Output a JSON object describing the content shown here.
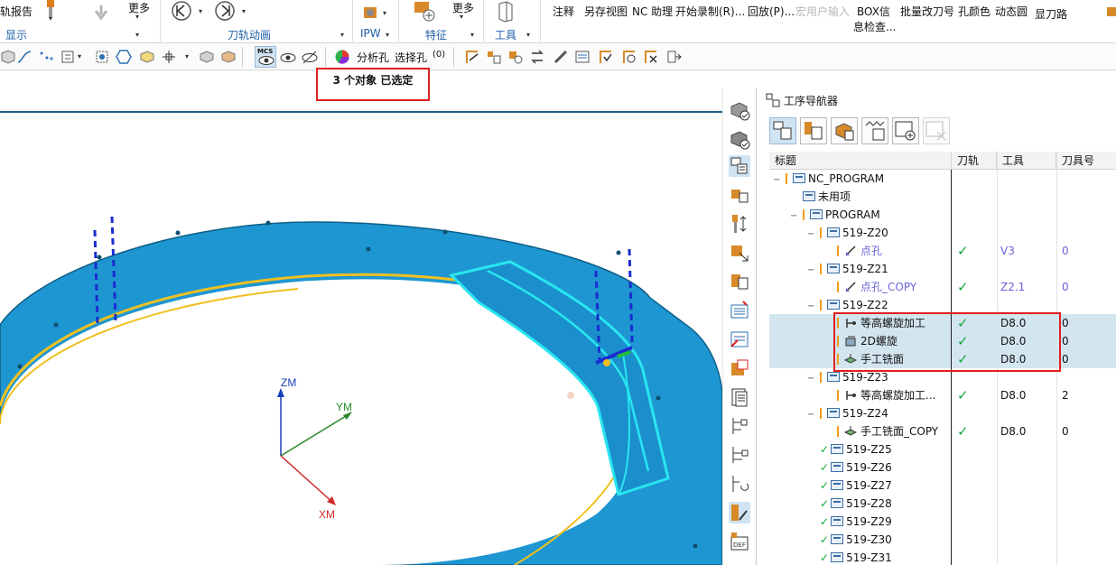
{
  "ribbon": {
    "report_label": "轨报告",
    "more_label_1": "更多",
    "group_display": "显示",
    "group_toolpath_anim": "刀轨动画",
    "group_ipw": "IPW",
    "group_feature": "特征",
    "more_label_2": "更多",
    "group_tools": "工具",
    "annotate": "注释",
    "save_view": "另存视图",
    "nc_assistant": "NC 助理",
    "start_record": "开始录制(R)...",
    "playback": "回放(P)...",
    "macro_input": "宏用户输入",
    "box_info_line1": "BOX信",
    "box_info_line2": "息检查...",
    "batch_change_tool": "批量改刀号",
    "hole_color": "孔颜色",
    "dynamic_circle": "动态圆",
    "show_toolpath": "显刀路"
  },
  "toolbar": {
    "analyze_hole": "分析孔",
    "select_hole": "选择孔",
    "mcs_label": "MCS",
    "hole_count_label": "(0)"
  },
  "status": {
    "selected_text": "3 个对象 已选定"
  },
  "viewport": {
    "axis_z": "ZM",
    "axis_y": "YM",
    "axis_x": "XM"
  },
  "navigator": {
    "title": "工序导航器",
    "columns": [
      "标题",
      "刀轨",
      "工具",
      "刀具号"
    ],
    "rows": [
      {
        "name": "NC_PROGRAM",
        "indent": 0,
        "type": "root",
        "path": "",
        "tool": "",
        "num": "",
        "expander": "−",
        "flag": true,
        "highlight": false,
        "blue": false
      },
      {
        "name": "未用项",
        "indent": 1,
        "type": "folder",
        "path": "",
        "tool": "",
        "num": "",
        "expander": "",
        "flag": false,
        "highlight": false,
        "blue": false
      },
      {
        "name": "PROGRAM",
        "indent": 1,
        "type": "folder",
        "path": "",
        "tool": "",
        "num": "",
        "expander": "−",
        "flag": true,
        "highlight": false,
        "blue": false
      },
      {
        "name": "519-Z20",
        "indent": 2,
        "type": "folder",
        "path": "",
        "tool": "",
        "num": "",
        "expander": "−",
        "flag": true,
        "highlight": false,
        "blue": false
      },
      {
        "name": "点孔",
        "indent": 3,
        "type": "op-drill",
        "path": "✓",
        "tool": "V3",
        "num": "0",
        "expander": "",
        "flag": true,
        "highlight": false,
        "blue": true
      },
      {
        "name": "519-Z21",
        "indent": 2,
        "type": "folder",
        "path": "",
        "tool": "",
        "num": "",
        "expander": "−",
        "flag": true,
        "highlight": false,
        "blue": false
      },
      {
        "name": "点孔_COPY",
        "indent": 3,
        "type": "op-drill",
        "path": "✓",
        "tool": "Z2.1",
        "num": "0",
        "expander": "",
        "flag": true,
        "highlight": false,
        "blue": true
      },
      {
        "name": "519-Z22",
        "indent": 2,
        "type": "folder",
        "path": "",
        "tool": "",
        "num": "",
        "expander": "−",
        "flag": true,
        "highlight": false,
        "blue": false
      },
      {
        "name": "等高螺旋加工",
        "indent": 3,
        "type": "op-helix",
        "path": "✓",
        "tool": "D8.0",
        "num": "0",
        "expander": "",
        "flag": true,
        "highlight": true,
        "blue": false
      },
      {
        "name": "2D螺旋",
        "indent": 3,
        "type": "op-2d",
        "path": "✓",
        "tool": "D8.0",
        "num": "0",
        "expander": "",
        "flag": true,
        "highlight": true,
        "blue": false
      },
      {
        "name": "手工铣面",
        "indent": 3,
        "type": "op-face",
        "path": "✓",
        "tool": "D8.0",
        "num": "0",
        "expander": "",
        "flag": true,
        "highlight": true,
        "blue": false
      },
      {
        "name": "519-Z23",
        "indent": 2,
        "type": "folder",
        "path": "",
        "tool": "",
        "num": "",
        "expander": "−",
        "flag": true,
        "highlight": false,
        "blue": false
      },
      {
        "name": "等高螺旋加工...",
        "indent": 3,
        "type": "op-helix",
        "path": "✓",
        "tool": "D8.0",
        "num": "2",
        "expander": "",
        "flag": true,
        "highlight": false,
        "blue": false
      },
      {
        "name": "519-Z24",
        "indent": 2,
        "type": "folder",
        "path": "",
        "tool": "",
        "num": "",
        "expander": "−",
        "flag": true,
        "highlight": false,
        "blue": false
      },
      {
        "name": "手工铣面_COPY",
        "indent": 3,
        "type": "op-face",
        "path": "✓",
        "tool": "D8.0",
        "num": "0",
        "expander": "",
        "flag": true,
        "highlight": false,
        "blue": false
      },
      {
        "name": "519-Z25",
        "indent": 2,
        "type": "folder-ok",
        "path": "",
        "tool": "",
        "num": "",
        "expander": "",
        "flag": false,
        "highlight": false,
        "blue": false
      },
      {
        "name": "519-Z26",
        "indent": 2,
        "type": "folder-ok",
        "path": "",
        "tool": "",
        "num": "",
        "expander": "",
        "flag": false,
        "highlight": false,
        "blue": false
      },
      {
        "name": "519-Z27",
        "indent": 2,
        "type": "folder-ok",
        "path": "",
        "tool": "",
        "num": "",
        "expander": "",
        "flag": false,
        "highlight": false,
        "blue": false
      },
      {
        "name": "519-Z28",
        "indent": 2,
        "type": "folder-ok",
        "path": "",
        "tool": "",
        "num": "",
        "expander": "",
        "flag": false,
        "highlight": false,
        "blue": false
      },
      {
        "name": "519-Z29",
        "indent": 2,
        "type": "folder-ok",
        "path": "",
        "tool": "",
        "num": "",
        "expander": "",
        "flag": false,
        "highlight": false,
        "blue": false
      },
      {
        "name": "519-Z30",
        "indent": 2,
        "type": "folder-ok",
        "path": "",
        "tool": "",
        "num": "",
        "expander": "",
        "flag": false,
        "highlight": false,
        "blue": false
      },
      {
        "name": "519-Z31",
        "indent": 2,
        "type": "folder-ok",
        "path": "",
        "tool": "",
        "num": "",
        "expander": "",
        "flag": false,
        "highlight": false,
        "blue": false
      }
    ]
  },
  "colors": {
    "accent_blue": "#1f5fa8",
    "ring_blue": "#1e96d1",
    "highlight_cyan": "#29e6f0",
    "selection_red": "#e02020",
    "check_green": "#14a83a",
    "row_highlight": "#d3e5ef"
  }
}
